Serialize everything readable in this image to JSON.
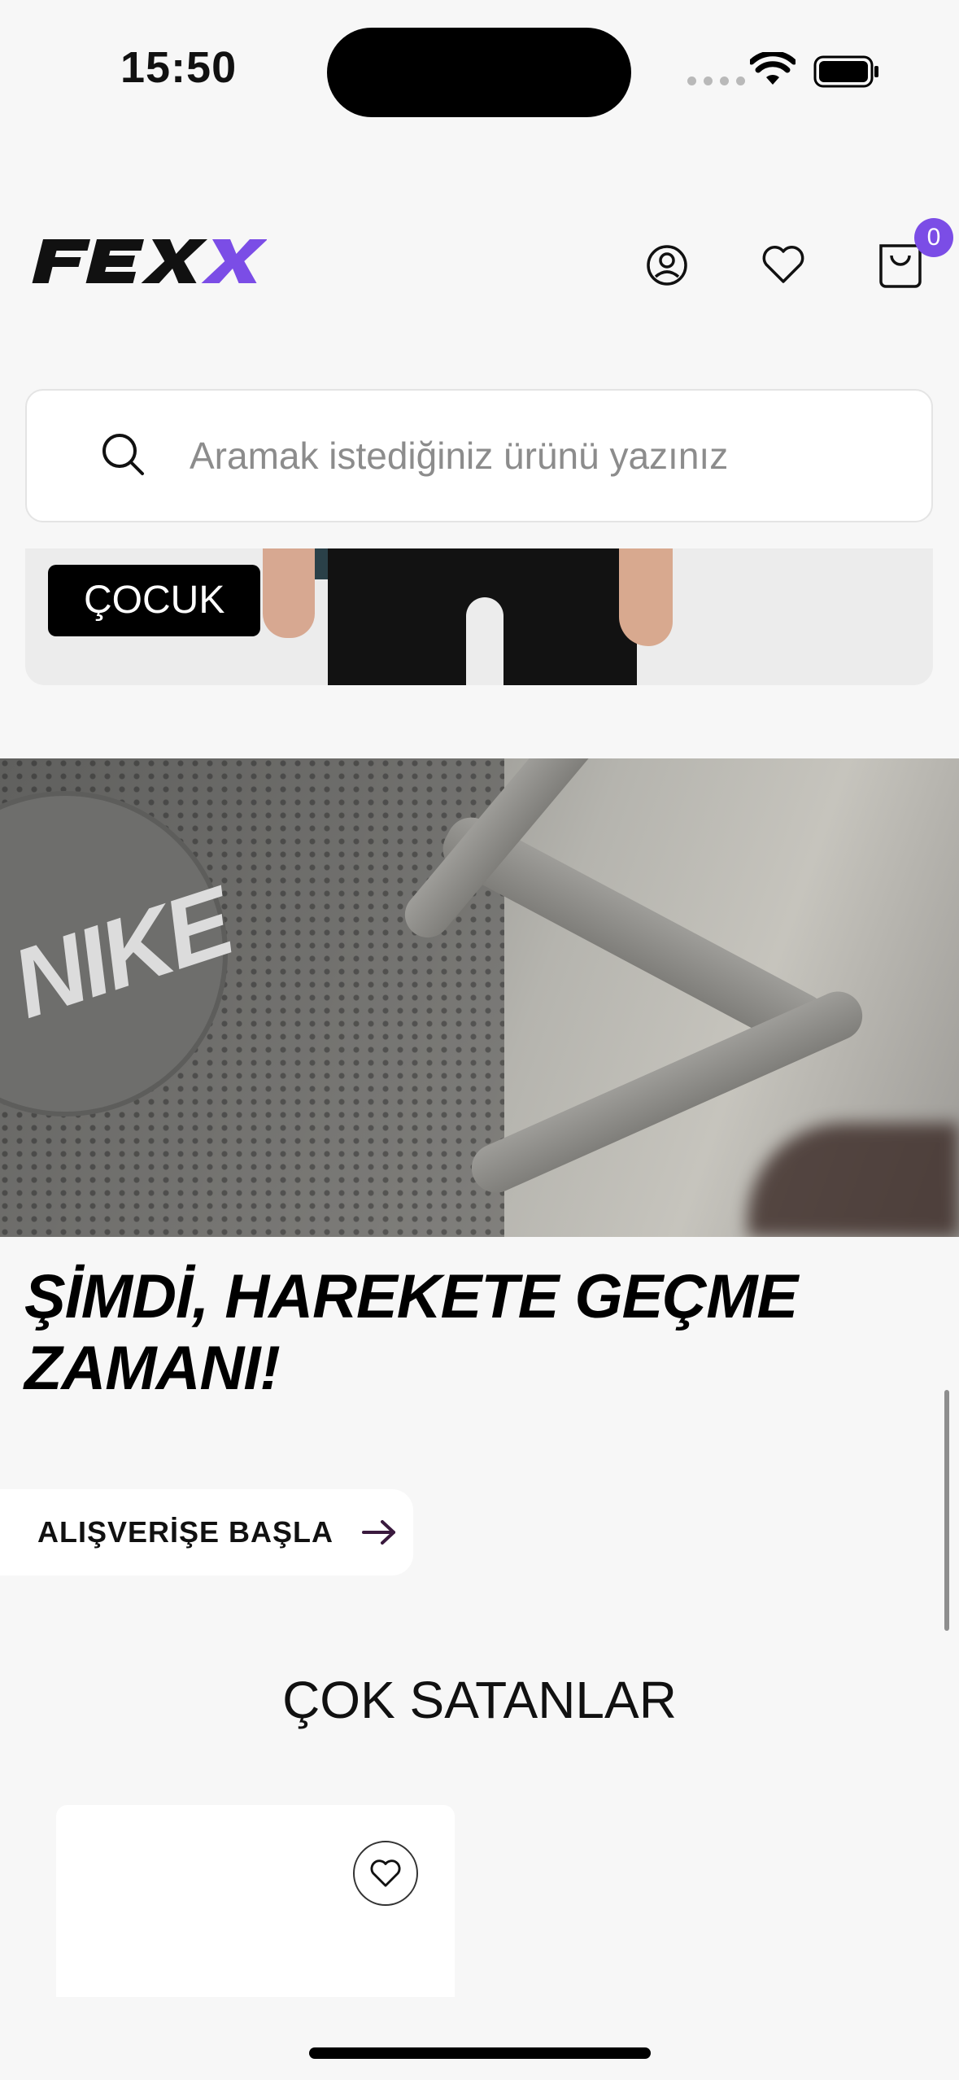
{
  "status_bar": {
    "time": "15:50"
  },
  "header": {
    "logo_text": "FEXX",
    "cart_count": "0",
    "icons": [
      "account-icon",
      "heart-icon",
      "cart-icon"
    ]
  },
  "search": {
    "placeholder": "Aramak istediğiniz ürünü yazınız"
  },
  "category_banner": {
    "label": "ÇOCUK"
  },
  "hero": {
    "headline": "ŞİMDİ, HAREKETE GEÇME ZAMANI!",
    "cta_label": "ALIŞVERİŞE BAŞLA"
  },
  "best_sellers": {
    "title": "ÇOK SATANLAR"
  },
  "colors": {
    "accent": "#7b4de6",
    "background": "#f7f7f7",
    "cta_arrow": "#3a1a3e"
  }
}
